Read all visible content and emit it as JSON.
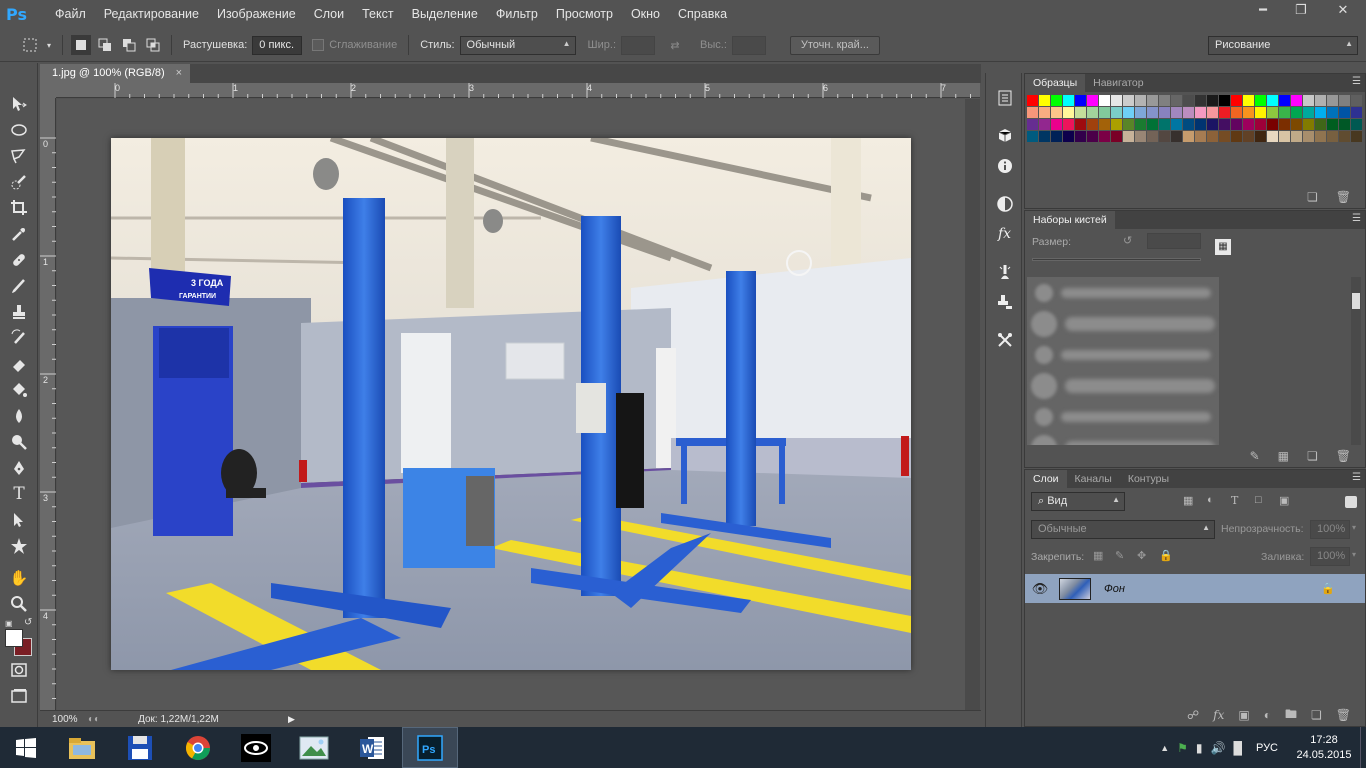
{
  "app": {
    "logo": "Ps",
    "menu": [
      "Файл",
      "Редактирование",
      "Изображение",
      "Слои",
      "Текст",
      "Выделение",
      "Фильтр",
      "Просмотр",
      "Окно",
      "Справка"
    ],
    "window_controls": [
      "minimize-icon",
      "restore-icon",
      "close-icon"
    ]
  },
  "options": {
    "feather_label": "Растушевка:",
    "feather_value": "0 пикс.",
    "antialias_label": "Сглаживание",
    "style_label": "Стиль:",
    "style_value": "Обычный",
    "width_label": "Шир.:",
    "height_label": "Выс.:",
    "refine_button": "Уточн. край...",
    "workspace_value": "Рисование"
  },
  "document": {
    "tab_title": "1.jpg @ 100% (RGB/8)",
    "tab_close": "×",
    "ruler_top": [
      "0",
      "1",
      "2",
      "3",
      "4",
      "5",
      "6",
      "7"
    ],
    "ruler_left": [
      "0",
      "1",
      "2",
      "3",
      "4"
    ],
    "zoom": "100%",
    "doc_info": "Док: 1,22M/1,22M",
    "photo_signs": [
      "3 ГОДА",
      "ГАРАНТИИ"
    ]
  },
  "panels": {
    "swatches": {
      "tabs": [
        "Образцы",
        "Навигатор"
      ]
    },
    "brushes": {
      "tab": "Наборы кистей",
      "size_label": "Размер:"
    },
    "layers": {
      "tabs": [
        "Слои",
        "Каналы",
        "Контуры"
      ],
      "filter_value": "Вид",
      "blend_value": "Обычные",
      "opacity_label": "Непрозрачность:",
      "opacity_value": "100%",
      "lock_label": "Закрепить:",
      "fill_label": "Заливка:",
      "fill_value": "100%",
      "layer_name": "Фон"
    }
  },
  "taskbar": {
    "apps": [
      "file-explorer-icon",
      "save-disk-icon",
      "chrome-icon",
      "eye-app-icon",
      "image-viewer-icon",
      "word-icon",
      "photoshop-icon"
    ],
    "language": "РУС",
    "time": "17:28",
    "date": "24.05.2015"
  },
  "colors": {
    "ui_bg": "#535353",
    "panel_dark": "#424242",
    "layer_selected": "#8fa3bf",
    "taskbar": "#1f2a36",
    "foreground_swatch": "#ffffff",
    "background_swatch": "#7a1e24"
  },
  "swatch_colors": [
    "#ff0000",
    "#ffff00",
    "#00ff00",
    "#00ffff",
    "#0000ff",
    "#ff00ff",
    "#ffffff",
    "#e6e6e6",
    "#cccccc",
    "#b3b3b3",
    "#999999",
    "#808080",
    "#666666",
    "#4d4d4d",
    "#333333",
    "#1a1a1a",
    "#000000",
    "#ff0000",
    "#ffff00",
    "#00ff00",
    "#00ffff",
    "#0000ff",
    "#ff00ff",
    "#c8c8c8",
    "#b0b0b0",
    "#989898",
    "#808080",
    "#5f5f5f",
    "#f7977a",
    "#f9ad81",
    "#fdc68a",
    "#fff79a",
    "#c4df9b",
    "#a2d39c",
    "#82ca9d",
    "#7bcdc8",
    "#6ecff6",
    "#7ea7d8",
    "#8493ca",
    "#8882be",
    "#a187be",
    "#bc8dbf",
    "#f49ac2",
    "#f6989d",
    "#ed1c24",
    "#f26522",
    "#f7941d",
    "#fff200",
    "#8dc73f",
    "#39b54a",
    "#00a651",
    "#00a99d",
    "#00aeef",
    "#0072bc",
    "#0054a6",
    "#2e3192",
    "#662d91",
    "#92278f",
    "#ec008c",
    "#ed145b",
    "#9e0b0f",
    "#a0410d",
    "#a36209",
    "#aba000",
    "#598527",
    "#1a7b30",
    "#007236",
    "#00746b",
    "#0076a3",
    "#004b80",
    "#003471",
    "#1b1464",
    "#440e62",
    "#630460",
    "#9e005d",
    "#9e0039",
    "#790000",
    "#7b2e00",
    "#7d4900",
    "#827b00",
    "#406618",
    "#005e20",
    "#005826",
    "#005952",
    "#005b7f",
    "#003663",
    "#002157",
    "#0d004c",
    "#32004b",
    "#4b0049",
    "#7b0046",
    "#7a0026",
    "#c7b299",
    "#998675",
    "#736357",
    "#534741",
    "#37302d",
    "#c69c6d",
    "#a67c52",
    "#8c6239",
    "#754c24",
    "#603913",
    "#614126",
    "#402611",
    "#e8d8c0",
    "#d8c4a4",
    "#c0aa88",
    "#a88e6c",
    "#907450",
    "#786040",
    "#604c30",
    "#483820"
  ]
}
